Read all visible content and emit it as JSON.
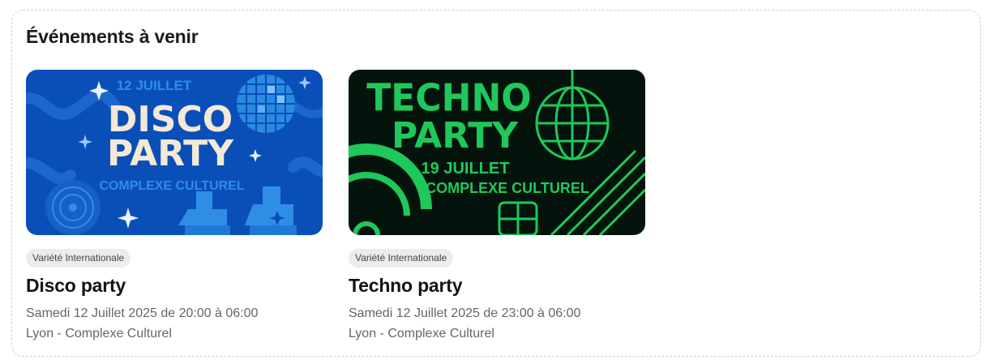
{
  "section": {
    "title": "Événements à venir"
  },
  "events": [
    {
      "poster": {
        "date_text": "12 JUILLET",
        "headline_1": "DISCO",
        "headline_2": "PARTY",
        "venue_text": "COMPLEXE CULTUREL",
        "bg_color": "#0a4fb8",
        "accent_color": "#2f8de6",
        "headline_color": "#f3e9d6"
      },
      "category": "Variété Internationale",
      "title": "Disco party",
      "date": "Samedi 12 Juillet 2025 de 20:00 à 06:00",
      "location": "Lyon - Complexe Culturel"
    },
    {
      "poster": {
        "headline_1": "TECHNO",
        "headline_2": "PARTY",
        "date_text": "19 JUILLET",
        "venue_text": "COMPLEXE CULTUREL",
        "bg_color": "#04140d",
        "accent_color": "#1fc85a"
      },
      "category": "Variété Internationale",
      "title": "Techno party",
      "date": "Samedi 12 Juillet 2025 de 23:00 à 06:00",
      "location": "Lyon - Complexe Culturel"
    }
  ]
}
